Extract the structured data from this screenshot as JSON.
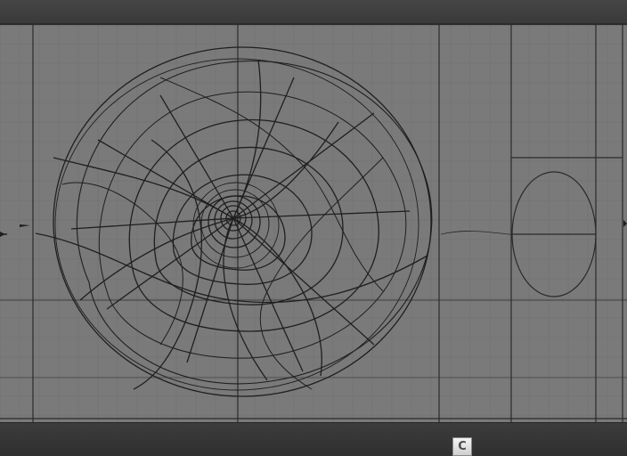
{
  "window": {
    "title": ""
  },
  "viewport": {
    "background": "#7a7a7a",
    "grid_color": "#6e6e6e",
    "frame_color": "#2a2a2a",
    "drawing_color": "#1f1f1f"
  },
  "toolbar": {
    "tool_button_icon": "c-shape-icon",
    "tool_button_glyph": "C"
  },
  "colors": {
    "chrome_dark": "#3e3e3e",
    "button_face": "#e8e8e8"
  }
}
